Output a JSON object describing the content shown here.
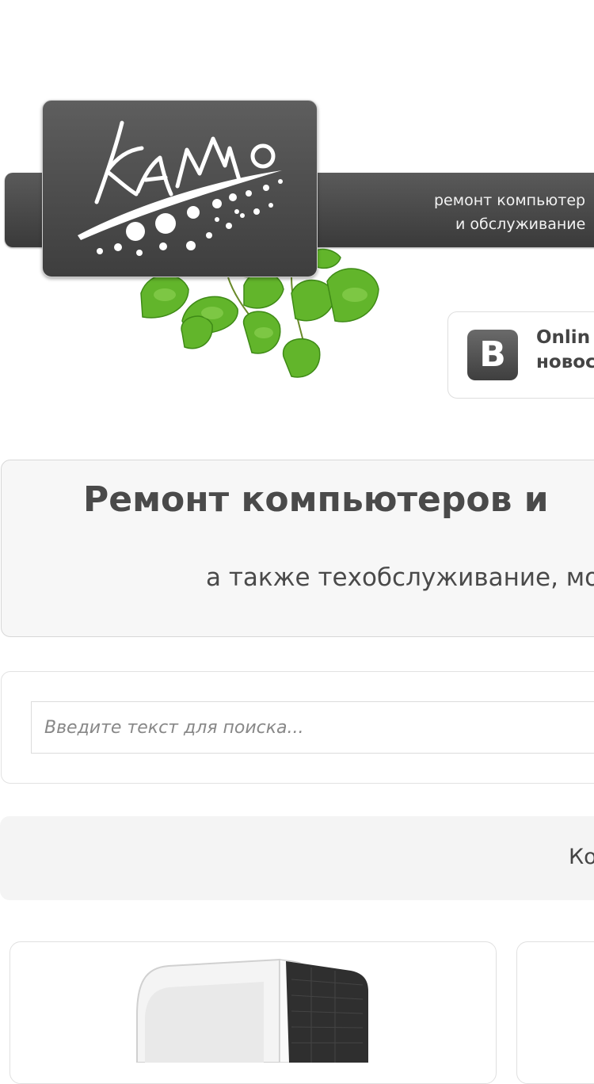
{
  "header": {
    "logo_text": "KaMo",
    "tagline_line1": "ремонт компьютер",
    "tagline_line2": "и обслуживание"
  },
  "vk_widget": {
    "icon_letter": "B",
    "line1": "Onlin",
    "line2": "новос"
  },
  "hero": {
    "title": "Ремонт компьютеров и",
    "subtitle": "а также техобслуживание, мо"
  },
  "search": {
    "placeholder": "Введите текст для поиска..."
  },
  "nav": {
    "link_label": "Ко"
  },
  "colors": {
    "header_bg": "#4a4a4a",
    "leaf_green": "#5fb82a",
    "panel_bg": "#f7f7f7"
  }
}
